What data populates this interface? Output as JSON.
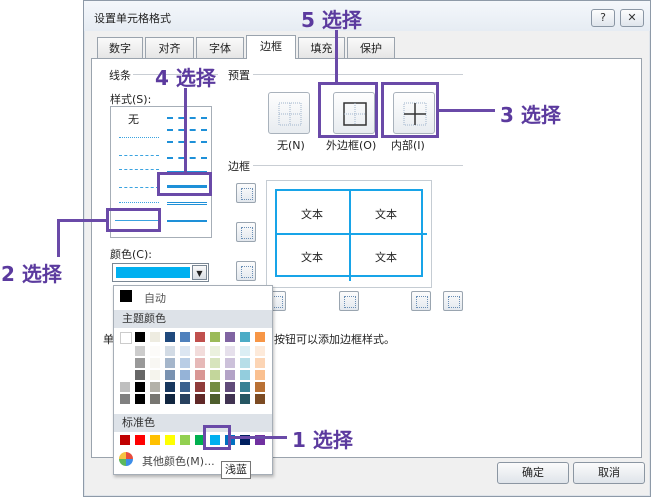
{
  "dialog": {
    "title": "设置单元格格式",
    "help_label": "?",
    "close_label": "✕",
    "tabs": [
      "数字",
      "对齐",
      "字体",
      "边框",
      "填充",
      "保护"
    ],
    "active_tab": "边框"
  },
  "line": {
    "group_label": "线条",
    "style_label": "样式(S):",
    "none_label": "无",
    "color_label": "颜色(C):",
    "color_value": "#00b0f0"
  },
  "presets": {
    "group_label": "预置",
    "items": [
      "无(N)",
      "外边框(O)",
      "内部(I)"
    ]
  },
  "border": {
    "group_label": "边框",
    "preview_cells": [
      "文本",
      "文本",
      "文本",
      "文本"
    ]
  },
  "hint": {
    "prefix": "单",
    "text": "按钮可以添加边框样式。"
  },
  "palette": {
    "auto_label": "自动",
    "theme_header": "主题颜色",
    "standard_header": "标准色",
    "more_colors_label": "其他颜色(M)...",
    "tooltip": "浅蓝",
    "theme_colors": [
      "#ffffff",
      "#000000",
      "#eeece1",
      "#1f497d",
      "#4f81bd",
      "#c0504d",
      "#9bbb59",
      "#8064a2",
      "#4bacc6",
      "#f79646"
    ],
    "standard_colors": [
      "#c00000",
      "#ff0000",
      "#ffc000",
      "#ffff00",
      "#92d050",
      "#00b050",
      "#00b0f0",
      "#0070c0",
      "#002060",
      "#7030a0"
    ]
  },
  "buttons": {
    "ok": "确定",
    "cancel": "取消"
  },
  "annotations": [
    "5 选择",
    "4 选择",
    "3 选择",
    "2 选择",
    "1 选择"
  ]
}
